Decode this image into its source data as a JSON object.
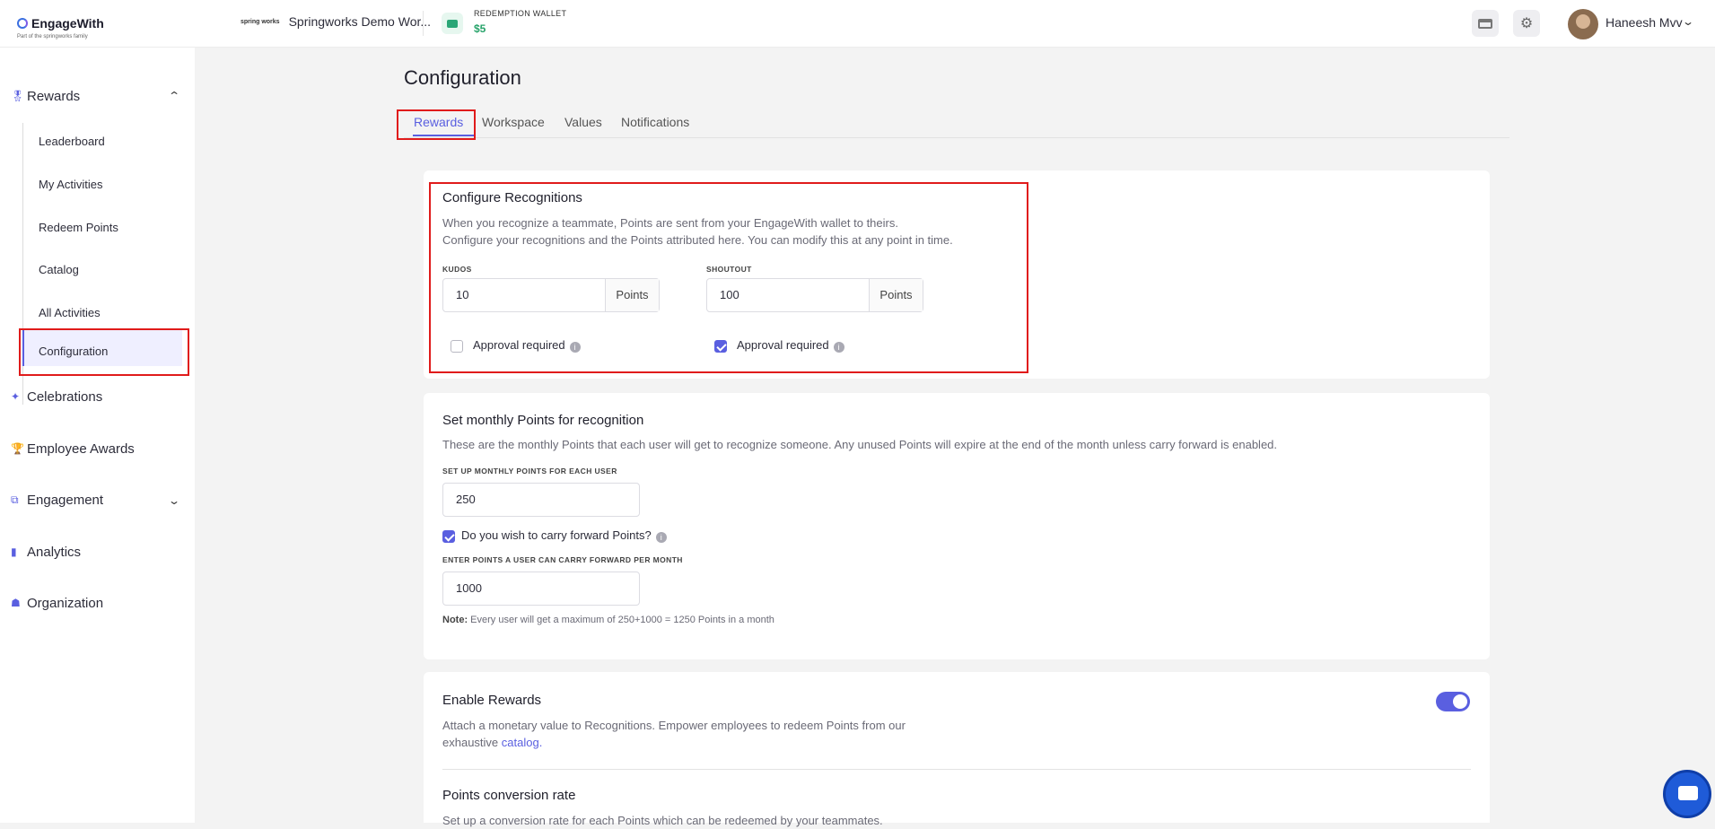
{
  "topbar": {
    "logo": "EngageWith",
    "logo_sub": "Part of the springworks family",
    "workspace_logo": "spring works",
    "workspace": "Springworks Demo Wor...",
    "wallet_label": "REDEMPTION WALLET",
    "wallet_value": "$5",
    "user_name": "Haneesh Mvv"
  },
  "sidebar": {
    "rewards": "Rewards",
    "sub_items": [
      "Leaderboard",
      "My Activities",
      "Redeem Points",
      "Catalog",
      "All Activities",
      "Configuration"
    ],
    "celebrations": "Celebrations",
    "employee_awards": "Employee Awards",
    "engagement": "Engagement",
    "analytics": "Analytics",
    "organization": "Organization"
  },
  "main": {
    "title": "Configuration",
    "tabs": [
      "Rewards",
      "Workspace",
      "Values",
      "Notifications"
    ],
    "recognitions": {
      "title": "Configure Recognitions",
      "desc1": "When you recognize a teammate, Points are sent from your EngageWith wallet to theirs.",
      "desc2": "Configure your recognitions and the Points attributed here. You can modify this at any point in time.",
      "kudos_label": "KUDOS",
      "kudos_value": "10",
      "shoutout_label": "SHOUTOUT",
      "shoutout_value": "100",
      "points_addon": "Points",
      "approval_label": "Approval required",
      "kudos_approval": false,
      "shoutout_approval": true
    },
    "monthly": {
      "title": "Set monthly Points for recognition",
      "desc": "These are the monthly Points that each user will get to recognize someone. Any unused Points will expire at the end of the month unless carry forward is enabled.",
      "setup_label": "SET UP MONTHLY POINTS FOR EACH USER",
      "setup_value": "250",
      "carry_label": "Do you wish to carry forward Points?",
      "carry_checked": true,
      "carry_input_label": "ENTER POINTS A USER CAN CARRY FORWARD PER MONTH",
      "carry_value": "1000",
      "note_prefix": "Note:",
      "note_text": "Every user will get a maximum of 250+1000 = 1250 Points in a month"
    },
    "rewards_enable": {
      "title": "Enable Rewards",
      "desc1": "Attach a monetary value to Recognitions. Empower employees to redeem Points from our",
      "desc2": "exhaustive",
      "link": "catalog.",
      "enabled": true,
      "conversion_title": "Points conversion rate",
      "conversion_desc": "Set up a conversion rate for each Points which can be redeemed by your teammates."
    }
  },
  "colors": {
    "accent": "#5a5fe0",
    "highlight": "#e01b1b",
    "wallet_green": "#27a36a"
  }
}
